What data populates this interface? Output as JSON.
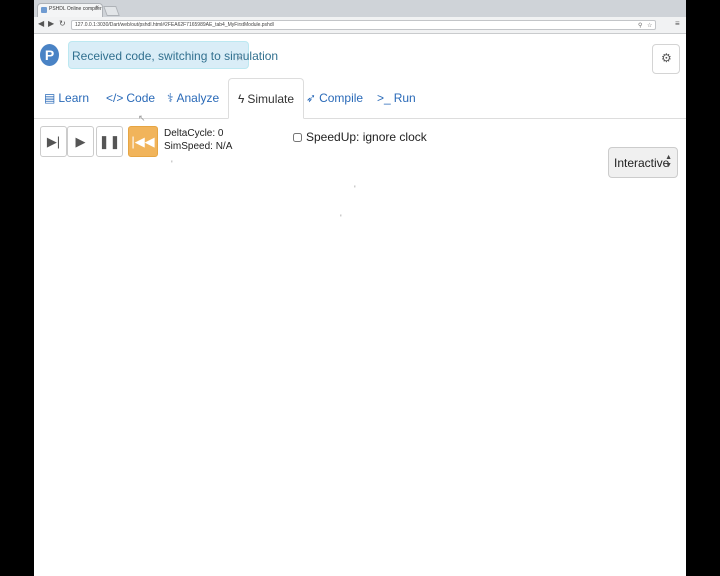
{
  "browser": {
    "tab_title": "PSHDL Online compiler",
    "tab_close": "×",
    "url": "127.0.0.1:3030/Dart/web/out/pshdl.html#2FEA62F7165989AE_tab4_MyFirstModule.pshdl"
  },
  "app": {
    "logo_letter": "P",
    "alert": {
      "text": "Received code, switching to simulation",
      "close": "×"
    }
  },
  "nav": {
    "tabs": [
      {
        "label": "Learn",
        "icon": "book-icon"
      },
      {
        "label": "Code",
        "icon": "code-icon"
      },
      {
        "label": "Analyze",
        "icon": "stethoscope-icon"
      },
      {
        "label": "Simulate",
        "icon": "bolt-icon",
        "active": true
      },
      {
        "label": "Compile",
        "icon": "rocket-icon"
      },
      {
        "label": "Run",
        "icon": "terminal-icon"
      }
    ]
  },
  "simulator": {
    "buttons": [
      {
        "name": "step-button",
        "icon": "step-forward-icon"
      },
      {
        "name": "play-button",
        "icon": "play-icon"
      },
      {
        "name": "pause-button",
        "icon": "pause-icon"
      },
      {
        "name": "reset-button",
        "icon": "fast-backward-icon"
      }
    ],
    "delta_cycle_label": "DeltaCycle:",
    "delta_cycle": "0",
    "sim_speed_label": "SimSpeed:",
    "sim_speed": "N/A",
    "speedup_label": "SpeedUp: ignore clock",
    "speedup_checked": false,
    "mode_value": "Interactive"
  },
  "colors": {
    "link": "#2a6ab8",
    "alert_bg": "#d9edf7",
    "warning": "#f1b45b",
    "logo": "#4a83c5"
  }
}
